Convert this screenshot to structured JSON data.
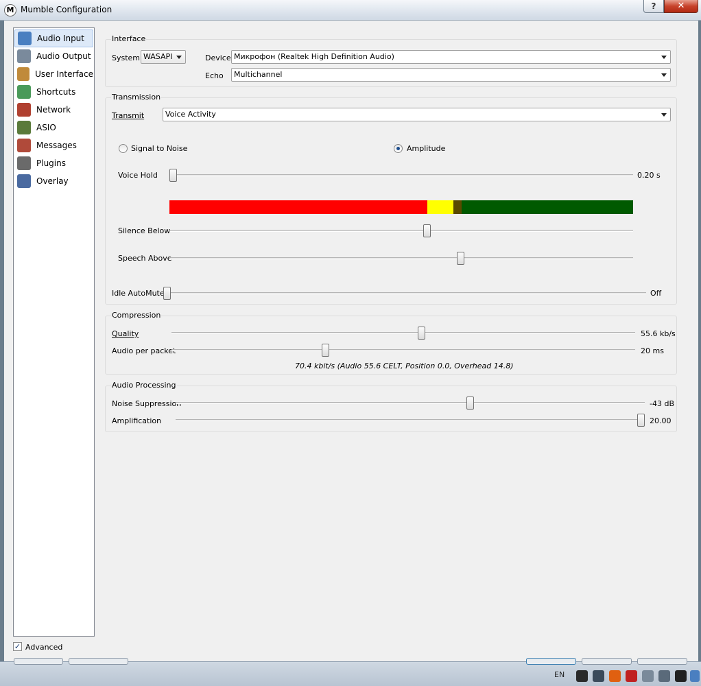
{
  "window": {
    "title": "Mumble Configuration",
    "help": "?",
    "close": "✕"
  },
  "sidebar": {
    "items": [
      {
        "label": "Audio Input",
        "icon": "microphone-icon",
        "color": "#4a7fc0",
        "selected": true
      },
      {
        "label": "Audio Output",
        "icon": "speaker-icon",
        "color": "#7a8a9c"
      },
      {
        "label": "User Interface",
        "icon": "user-interface-icon",
        "color": "#c08a3a"
      },
      {
        "label": "Shortcuts",
        "icon": "shortcuts-icon",
        "color": "#4a9a5a"
      },
      {
        "label": "Network",
        "icon": "network-icon",
        "color": "#b04030"
      },
      {
        "label": "ASIO",
        "icon": "asio-icon",
        "color": "#5a7a3a"
      },
      {
        "label": "Messages",
        "icon": "messages-icon",
        "color": "#b04a3a"
      },
      {
        "label": "Plugins",
        "icon": "plugins-icon",
        "color": "#6a6a6a"
      },
      {
        "label": "Overlay",
        "icon": "overlay-icon",
        "color": "#4a6aa0"
      }
    ]
  },
  "interface": {
    "title": "Interface",
    "system_label": "System",
    "system_value": "WASAPI",
    "device_label": "Device",
    "device_value": "Микрофон (Realtek High Definition Audio)",
    "echo_label": "Echo",
    "echo_value": "Multichannel"
  },
  "transmission": {
    "title": "Transmission",
    "transmit_label": "Transmit",
    "transmit_value": "Voice Activity",
    "signal_to_noise": "Signal to Noise",
    "amplitude": "Amplitude",
    "selected_mode": "Amplitude",
    "voice_hold_label": "Voice Hold",
    "voice_hold_value": "0.20 s",
    "voice_hold_level": 0.0,
    "meter_colors": {
      "red": "#ff0000",
      "yellow": "#ffff00",
      "dark_yellow": "#5a4a00",
      "green": "#005a00"
    },
    "meter_segments": [
      0.556,
      0.056,
      0.018,
      0.37
    ],
    "silence_below_label": "Silence Below",
    "silence_below_level": 0.556,
    "speech_above_label": "Speech Above",
    "speech_above_level": 0.63,
    "idle_automute_label": "Idle AutoMute",
    "idle_automute_value": "Off",
    "idle_automute_level": 0.0
  },
  "compression": {
    "title": "Compression",
    "quality_label": "Quality",
    "quality_value": "55.6 kb/s",
    "quality_level": 0.54,
    "audio_per_packet_label": "Audio per packet",
    "audio_per_packet_value": "20 ms",
    "audio_per_packet_level": 0.33,
    "summary": "70.4 kbit/s (Audio 55.6 CELT, Position 0.0, Overhead 14.8)"
  },
  "audio_processing": {
    "title": "Audio Processing",
    "noise_suppression_label": "Noise Suppression",
    "noise_suppression_value": "-43 dB",
    "noise_suppression_level": 0.63,
    "amplification_label": "Amplification",
    "amplification_value": "20.00",
    "amplification_level": 1.0
  },
  "footer": {
    "advanced_label": "Advanced",
    "advanced_checked": true
  },
  "taskbar": {
    "language": "EN"
  }
}
